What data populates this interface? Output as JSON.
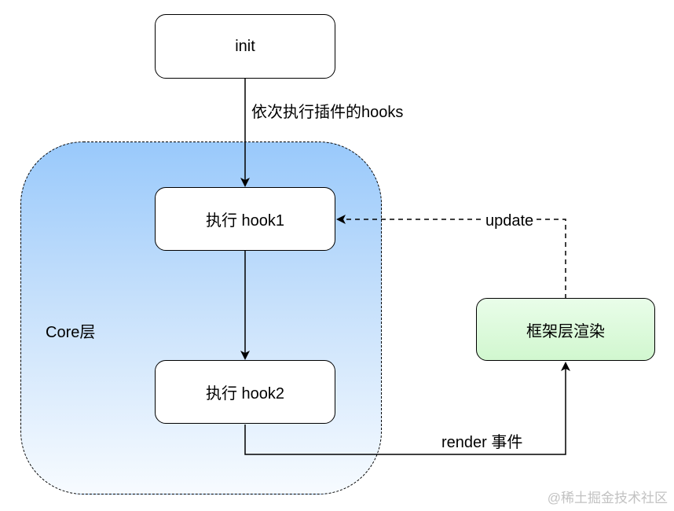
{
  "nodes": {
    "init": "init",
    "hook1": "执行 hook1",
    "hook2": "执行 hook2",
    "framework_render": "框架层渲染"
  },
  "region": {
    "core_label": "Core层"
  },
  "edges": {
    "init_to_hook1": "依次执行插件的hooks",
    "render_event": "render 事件",
    "update": "update"
  },
  "watermark": "@稀土掘金技术社区",
  "colors": {
    "core_gradient_top": "#99c9fb",
    "core_gradient_bottom": "#f7fbff",
    "framework_fill": "#d1f7cf"
  }
}
